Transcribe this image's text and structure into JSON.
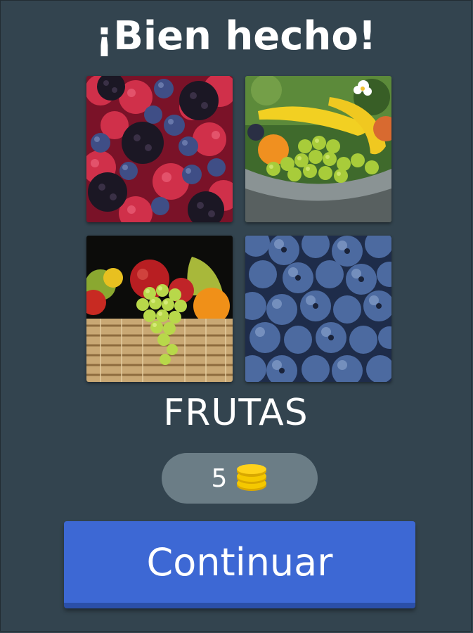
{
  "header": {
    "title": "¡Bien hecho!"
  },
  "tiles": [
    {
      "subject": "raspberries, blackberries and blueberries"
    },
    {
      "subject": "bananas, grapes and fruit bowl"
    },
    {
      "subject": "fruit basket with grapes, apples and pears"
    },
    {
      "subject": "blueberries"
    }
  ],
  "answer": {
    "word": "FRUTAS"
  },
  "reward": {
    "value": "5",
    "icon": "coins-icon"
  },
  "actions": {
    "continue_label": "Continuar"
  },
  "colors": {
    "background": "#33444f",
    "reward_pill": "#6b7d86",
    "button": "#3d68d4",
    "coin": "#f5c800"
  }
}
